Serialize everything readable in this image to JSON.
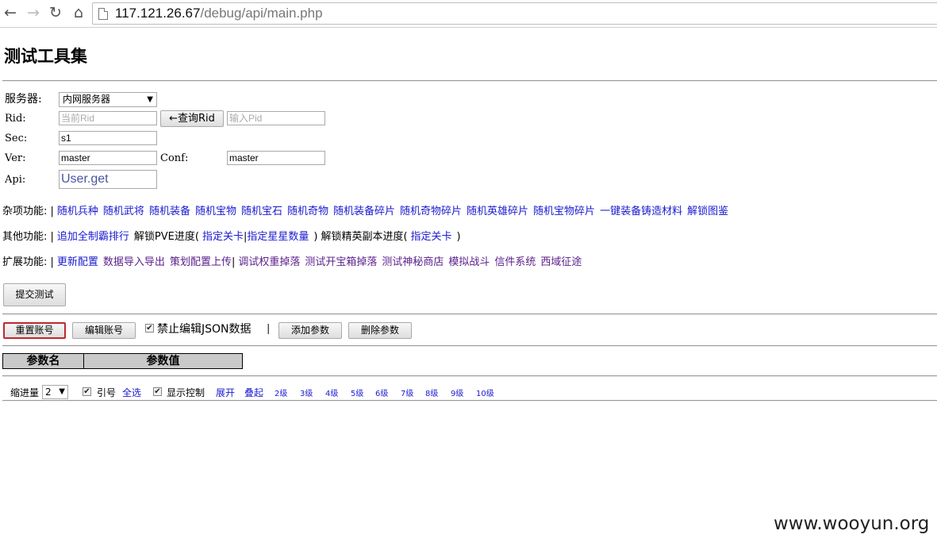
{
  "browser": {
    "url_host": "117.121.26.67",
    "url_path": "/debug/api/main.php"
  },
  "page": {
    "title": "测试工具集"
  },
  "form": {
    "server_label": "服务器:",
    "server_value": "内网服务器",
    "rid_label": "Rid:",
    "rid_placeholder": "当前Rid",
    "query_rid_button": "←查询Rid",
    "pid_placeholder": "输入Pid",
    "sec_label": "Sec:",
    "sec_value": "s1",
    "ver_label": "Ver:",
    "ver_value": "master",
    "conf_label": "Conf:",
    "conf_value": "master",
    "api_label": "Api:",
    "api_value": "User.get"
  },
  "misc_row": {
    "label": "杂项功能: |",
    "links": [
      "随机兵种",
      "随机武将",
      "随机装备",
      "随机宝物",
      "随机宝石",
      "随机奇物",
      "随机装备碎片",
      "随机奇物碎片",
      "随机英雄碎片",
      "随机宝物碎片",
      "一键装备铸造材料",
      "解锁图鉴"
    ]
  },
  "other_row": {
    "label": "其他功能: |",
    "link_rank": "追加全制霸排行",
    "text_pve": "解锁PVE进度(",
    "link_level": "指定关卡",
    "sep": "|",
    "link_stars": "指定星星数量",
    "close1": ")",
    "text_elite": "解锁精英副本进度(",
    "link_level2": "指定关卡",
    "close2": ")"
  },
  "ext_row": {
    "label": "扩展功能: |",
    "link1": "更新配置",
    "link2": "数据导入导出",
    "link3": "策划配置上传",
    "sep": "|",
    "links_rest": [
      "调试权重掉落",
      "测试开宝箱掉落",
      "测试神秘商店",
      "模拟战斗",
      "信件系统",
      "西域征途"
    ]
  },
  "actions": {
    "submit": "提交测试",
    "reset_account": "重置账号",
    "edit_account": "编辑账号",
    "forbid_json": "禁止编辑JSON数据",
    "divider": "|",
    "add_param": "添加参数",
    "delete_param": "删除参数"
  },
  "table": {
    "col_name": "参数名",
    "col_value": "参数值"
  },
  "footer": {
    "indent_label": "缩进量",
    "indent_value": "2",
    "quote_label": "引号",
    "select_all": "全选",
    "show_control": "显示控制",
    "expand": "展开",
    "collapse": "叠起",
    "levels": [
      "2级",
      "3级",
      "4级",
      "5级",
      "6级",
      "7级",
      "8级",
      "9级",
      "10级"
    ]
  },
  "watermark": "www.wooyun.org"
}
